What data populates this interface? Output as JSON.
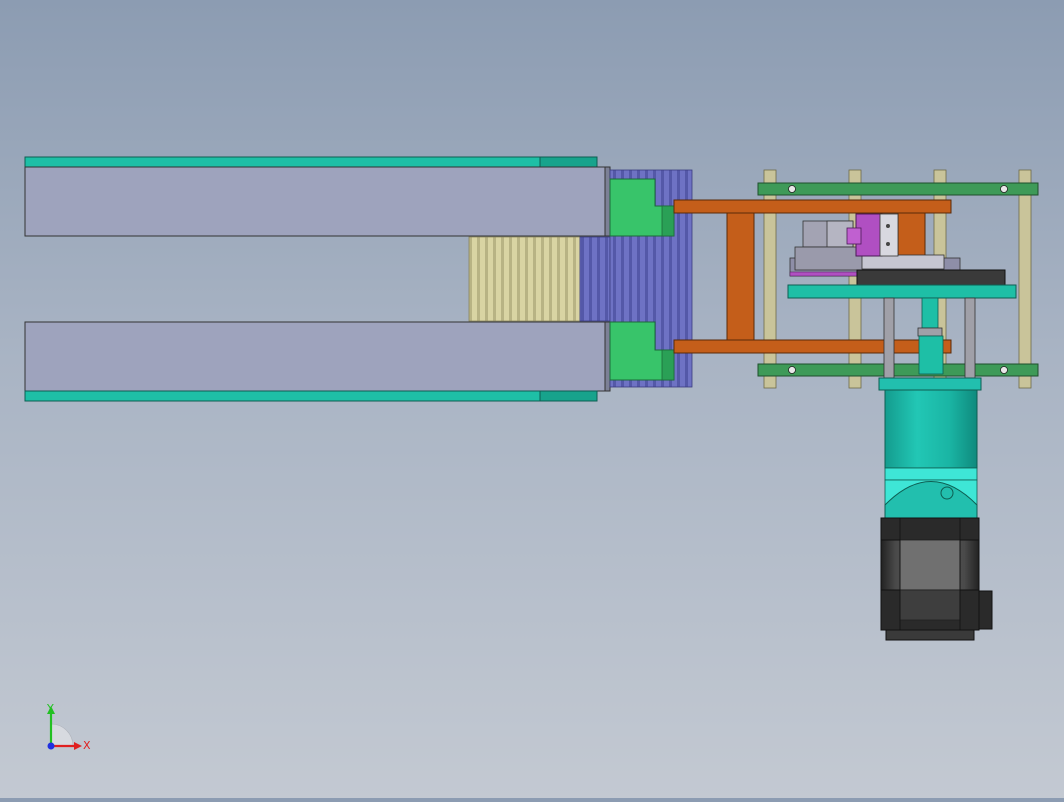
{
  "viewport": {
    "background_top": "#8c9cb2",
    "background_bottom": "#c3c9d2"
  },
  "triad": {
    "y_label": "Y",
    "x_label": "X",
    "y_color": "#22c022",
    "x_color": "#e02020",
    "z_color": "#2030e0"
  },
  "colors": {
    "teal": "#1ebfa6",
    "teal_dark": "#17a38c",
    "slab": "#9ea3bd",
    "green_block": "#38c46a",
    "bellows_yellow": "#d9d4a3",
    "bellows_blue": "#6e72c4",
    "orange_frame": "#c45e1a",
    "green_rail": "#3e9a58",
    "rod": "#c9c49a",
    "magenta": "#b04fc2",
    "motor_black": "#3a3a3a",
    "motor_grey": "#707070",
    "gearbox_teal": "#22bfae",
    "gearbox_cyan": "#3ee6d6"
  }
}
